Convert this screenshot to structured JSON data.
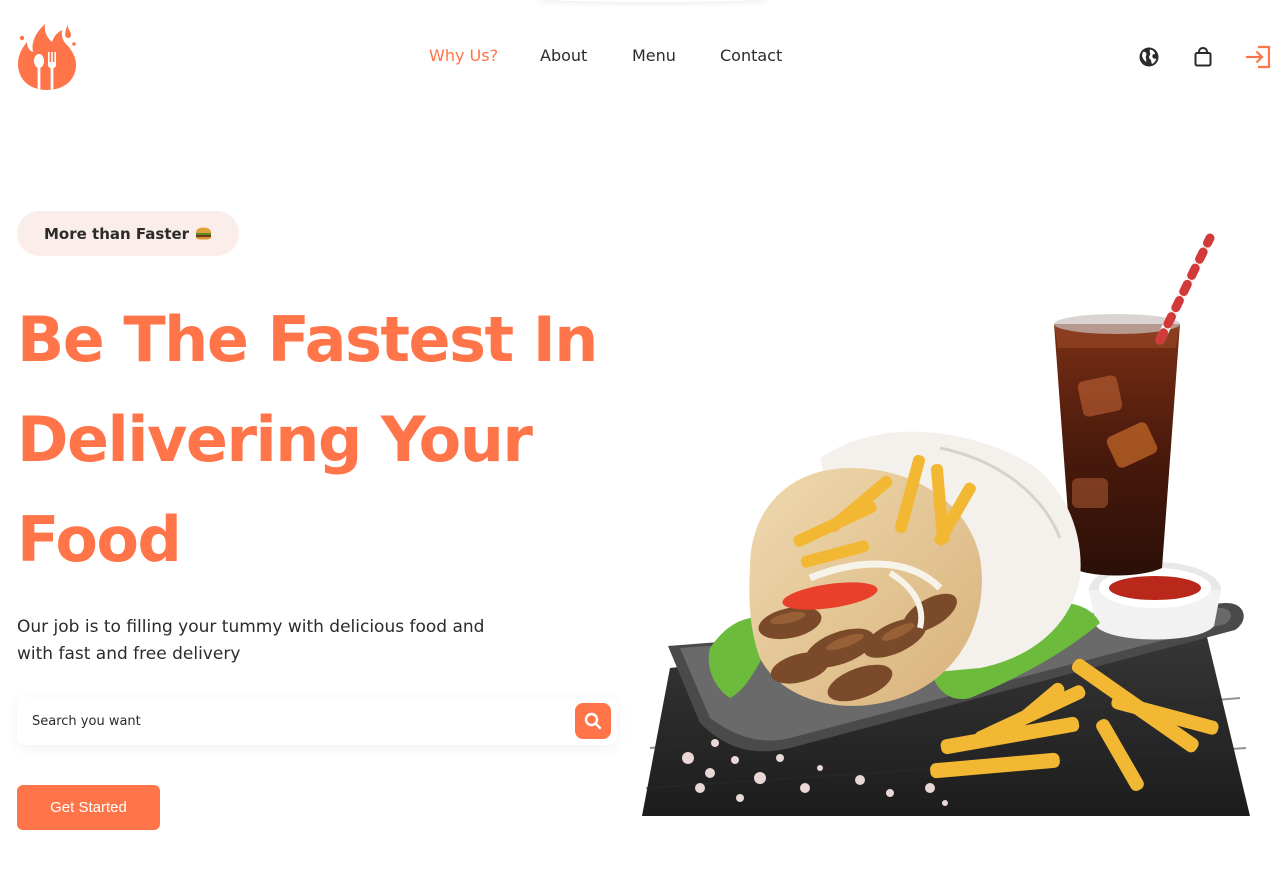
{
  "brand": {
    "accent": "#ff7448",
    "text": "#2b2b2b",
    "badge_bg": "#fbeeea"
  },
  "nav": {
    "items": [
      {
        "label": "Why Us?",
        "active": true
      },
      {
        "label": "About",
        "active": false
      },
      {
        "label": "Menu",
        "active": false
      },
      {
        "label": "Contact",
        "active": false
      }
    ]
  },
  "header_icons": [
    "globe-icon",
    "shopping-bag-icon",
    "login-icon"
  ],
  "hero": {
    "badge": "More than Faster",
    "headline": [
      "Be The Fastest In",
      "Delivering Your",
      "Food"
    ],
    "subtitle": [
      "Our job is to filling your tummy with delicious food and",
      "with fast and free delivery"
    ],
    "search_placeholder": "Search you want",
    "cta": "Get Started"
  }
}
